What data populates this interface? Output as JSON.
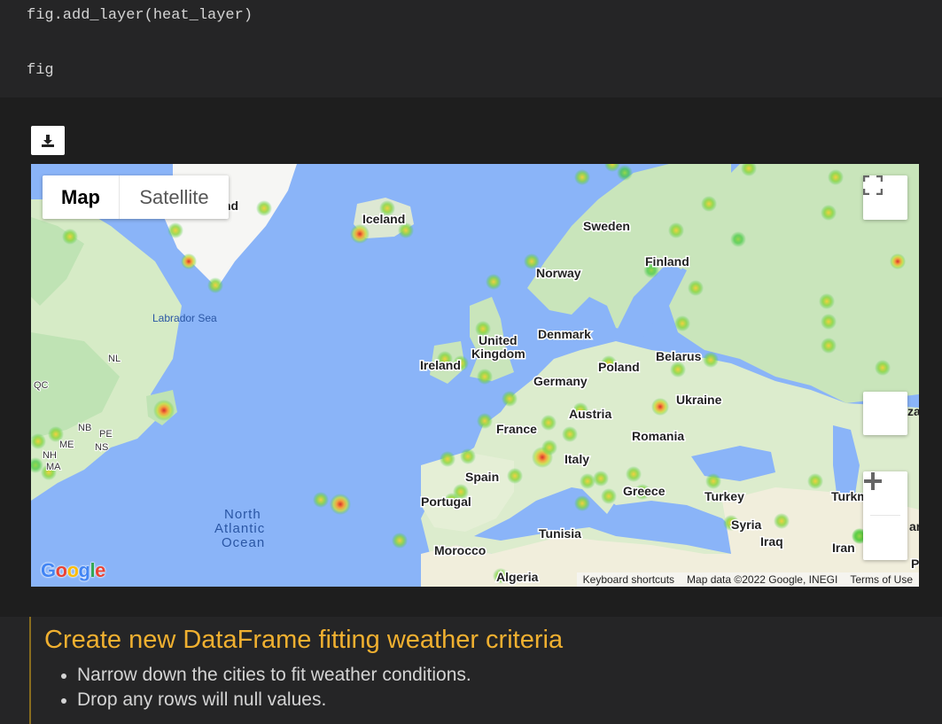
{
  "code": {
    "line1": "fig.add_layer(heat_layer)",
    "line2": "fig"
  },
  "toolbar": {
    "download_icon": "download-icon"
  },
  "map": {
    "maptype_buttons": [
      "Map",
      "Satellite"
    ],
    "active_maptype": "Map",
    "controls": {
      "fullscreen_icon": "fullscreen-icon",
      "zoom_in_icon": "plus-icon",
      "zoom_out_icon": "minus-icon"
    },
    "labels": {
      "sweden": "Sweden",
      "iceland": "Iceland",
      "norway": "Norway",
      "finland": "Finland",
      "labrador_sea": "Labrador Sea",
      "nl": "NL",
      "qc": "QC",
      "denmark": "Denmark",
      "united": "United",
      "kingdom": "Kingdom",
      "ireland": "Ireland",
      "belarus": "Belarus",
      "poland": "Poland",
      "germany": "Germany",
      "ukraine": "Ukraine",
      "austria": "Austria",
      "france": "France",
      "romania": "Romania",
      "nb": "NB",
      "pe": "PE",
      "ns": "NS",
      "me": "ME",
      "nh": "NH",
      "ma": "MA",
      "italy": "Italy",
      "spain": "Spain",
      "portugal": "Portugal",
      "greece": "Greece",
      "turkey": "Turkey",
      "north": "North",
      "atlantic": "Atlantic",
      "ocean": "Ocean",
      "syria": "Syria",
      "iraq": "Iraq",
      "iran": "Iran",
      "tunisia": "Tunisia",
      "morocco": "Morocco",
      "algeria": "Algeria",
      "greenland_partial": "nd",
      "kaz_partial": "za",
      "turkmen_partial": "Turkm",
      "an_partial": "an",
      "p_partial": "P"
    },
    "footer": {
      "shortcuts": "Keyboard shortcuts",
      "data": "Map data ©2022 Google, INEGI",
      "terms": "Terms of Use"
    },
    "colors": {
      "water": "#8ab4f8",
      "land": "#e8f0d8",
      "forest": "#bfe3b4",
      "hot": "#d9302c",
      "warm": "#f4d03f",
      "cool": "#3ec83e"
    },
    "heat_points": [
      {
        "name": "reykjavik",
        "level": "high"
      },
      {
        "name": "azores",
        "level": "high"
      },
      {
        "name": "newfoundland",
        "level": "high"
      },
      {
        "name": "italy-north",
        "level": "high"
      },
      {
        "name": "greece",
        "level": "medium"
      }
    ]
  },
  "markdown": {
    "heading": "Create new DataFrame fitting weather criteria",
    "bullets": [
      "Narrow down the cities to fit weather conditions.",
      "Drop any rows will null values."
    ]
  }
}
